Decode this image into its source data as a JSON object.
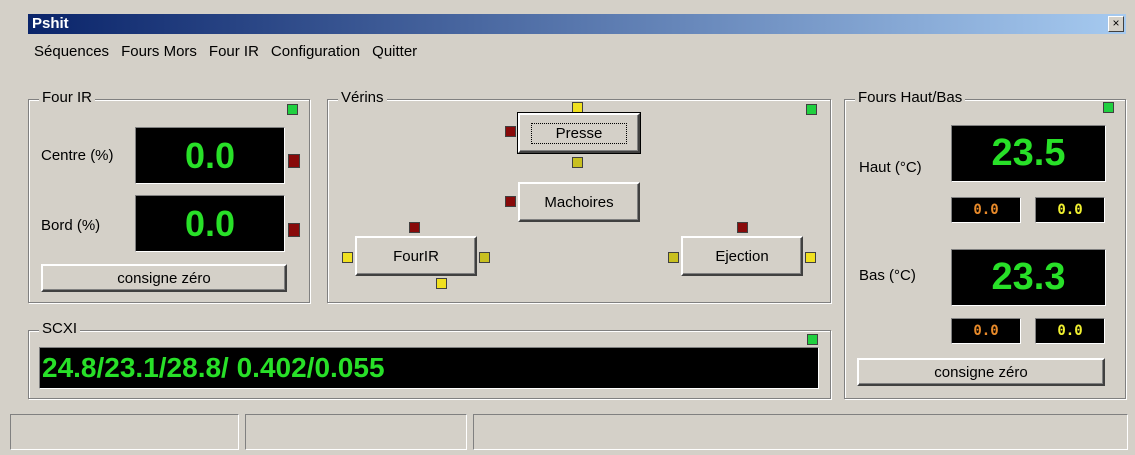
{
  "window": {
    "title": "Pshit",
    "close_glyph": "×"
  },
  "menu": [
    "Séquences",
    "Fours Mors",
    "Four IR",
    "Configuration",
    "Quitter"
  ],
  "four_ir": {
    "legend": "Four IR",
    "centre_label": "Centre (%)",
    "centre_value": "0.0",
    "bord_label": "Bord (%)",
    "bord_value": "0.0",
    "button": "consigne zéro"
  },
  "verins": {
    "legend": "Vérins",
    "presse": "Presse",
    "machoires": "Machoires",
    "fourir": "FourIR",
    "ejection": "Ejection"
  },
  "scxi": {
    "legend": "SCXI",
    "value": "24.8/23.1/28.8/ 0.402/0.055"
  },
  "fours_haut_bas": {
    "legend": "Fours Haut/Bas",
    "haut_label": "Haut (°C)",
    "haut_value": "23.5",
    "haut_small_1": "0.0",
    "haut_small_2": "0.0",
    "bas_label": "Bas (°C)",
    "bas_value": "23.3",
    "bas_small_1": "0.0",
    "bas_small_2": "0.0",
    "button": "consigne zéro"
  },
  "status_panels": [
    "",
    "",
    ""
  ],
  "colors": {
    "display_green": "#28e028",
    "small_orange": "#e88a2a",
    "small_yellow": "#f0f030"
  }
}
